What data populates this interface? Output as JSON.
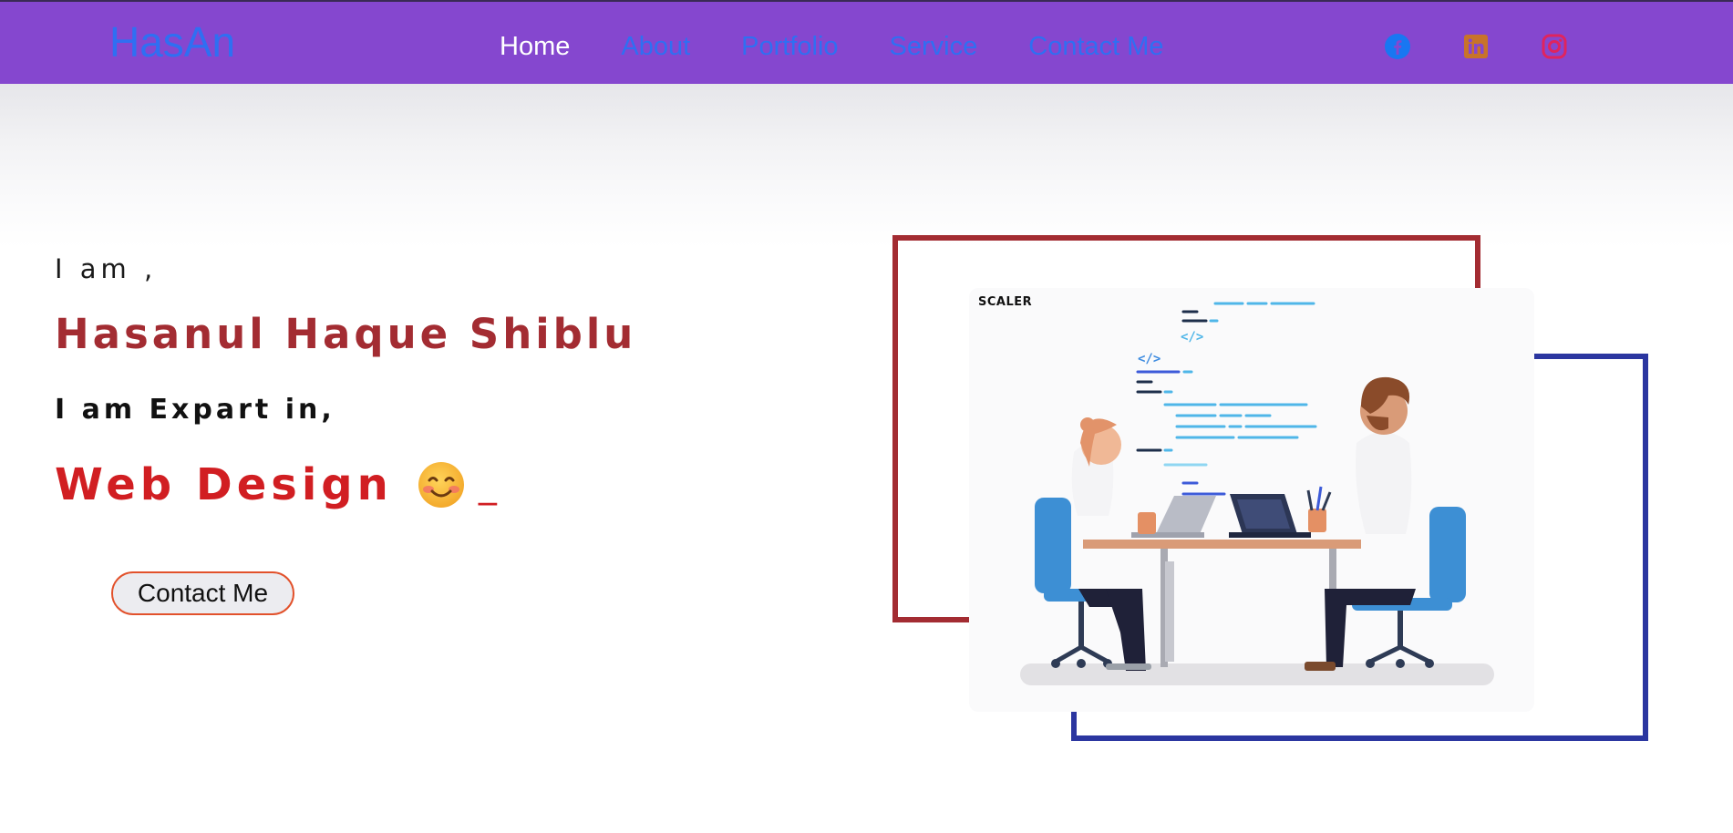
{
  "nav": {
    "logo": "HasAn",
    "links": [
      {
        "label": "Home",
        "active": true
      },
      {
        "label": "About",
        "active": false
      },
      {
        "label": "Portfolio",
        "active": false
      },
      {
        "label": "Service",
        "active": false
      },
      {
        "label": "Contact Me",
        "active": false
      }
    ],
    "social": [
      {
        "icon": "facebook-icon",
        "color": "#1877f2"
      },
      {
        "icon": "linkedin-icon",
        "color": "#c8732a"
      },
      {
        "icon": "instagram-icon",
        "color": "#e0245e"
      }
    ]
  },
  "hero": {
    "greeting": "I am ,",
    "name": "Hasanul Haque Shiblu",
    "expert_label": "I am Expart in,",
    "skill": "Web Design",
    "cursor": "_",
    "contact_button": "Contact Me"
  },
  "illustration": {
    "brand": "SCALER",
    "code_tags": [
      "</>",
      "</>"
    ]
  },
  "colors": {
    "nav_bg": "#8547cf",
    "link": "#2f6ff2",
    "name": "#a32c32",
    "skill": "#d11e22",
    "frame_red": "#a32c32",
    "frame_blue": "#2b36a0"
  }
}
